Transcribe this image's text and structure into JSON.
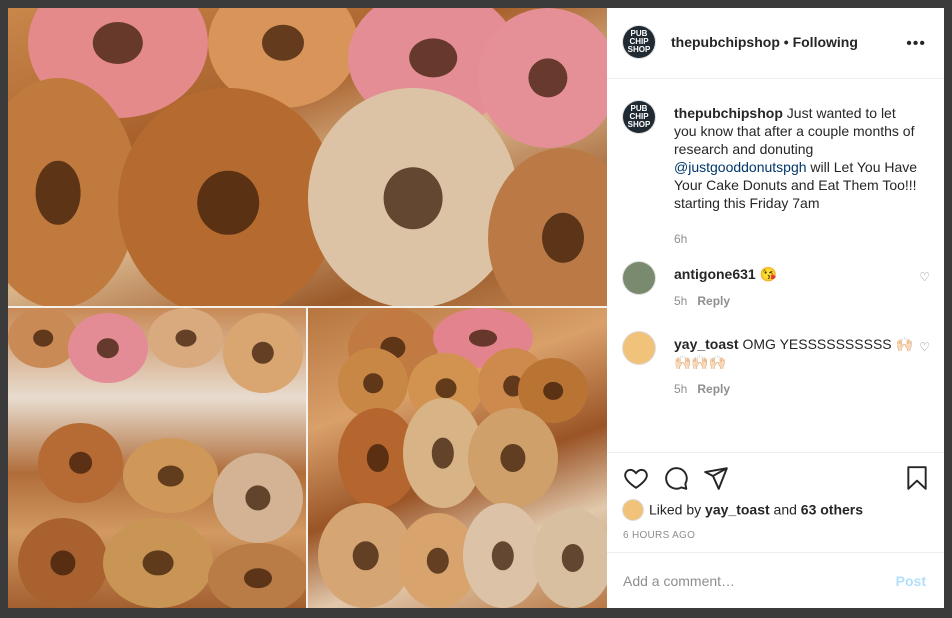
{
  "post": {
    "username": "thepubchipshop",
    "follow_status": "• Following",
    "avatar_text": "PUB CHIP SHOP",
    "more_icon": "more-horizontal-icon"
  },
  "caption": {
    "username": "thepubchipshop",
    "text_before": " Just wanted to let you know that after a couple months of research and donuting ",
    "mention": "@justgooddonutspgh",
    "text_after": " will Let You Have Your Cake Donuts and Eat Them Too!!! starting this Friday 7am",
    "time": "6h"
  },
  "comments": [
    {
      "username": "antigone631",
      "text": "😘",
      "time": "5h",
      "reply_label": "Reply"
    },
    {
      "username": "yay_toast",
      "text": "OMG YESSSSSSSSSS 🙌🏻🙌🏻🙌🏻🙌🏻",
      "time": "5h",
      "reply_label": "Reply"
    }
  ],
  "actions": {
    "like_icon": "heart-icon",
    "comment_icon": "comment-icon",
    "share_icon": "share-icon",
    "save_icon": "bookmark-icon"
  },
  "likes": {
    "prefix": "Liked by ",
    "user": "yay_toast",
    "middle": " and ",
    "others": "63 others"
  },
  "timestamp": "6 HOURS AGO",
  "add_comment": {
    "placeholder": "Add a comment…",
    "post_label": "Post"
  },
  "colors": {
    "mention": "#00376b",
    "post_disabled": "#b2dffc",
    "muted": "#8e8e8e"
  }
}
